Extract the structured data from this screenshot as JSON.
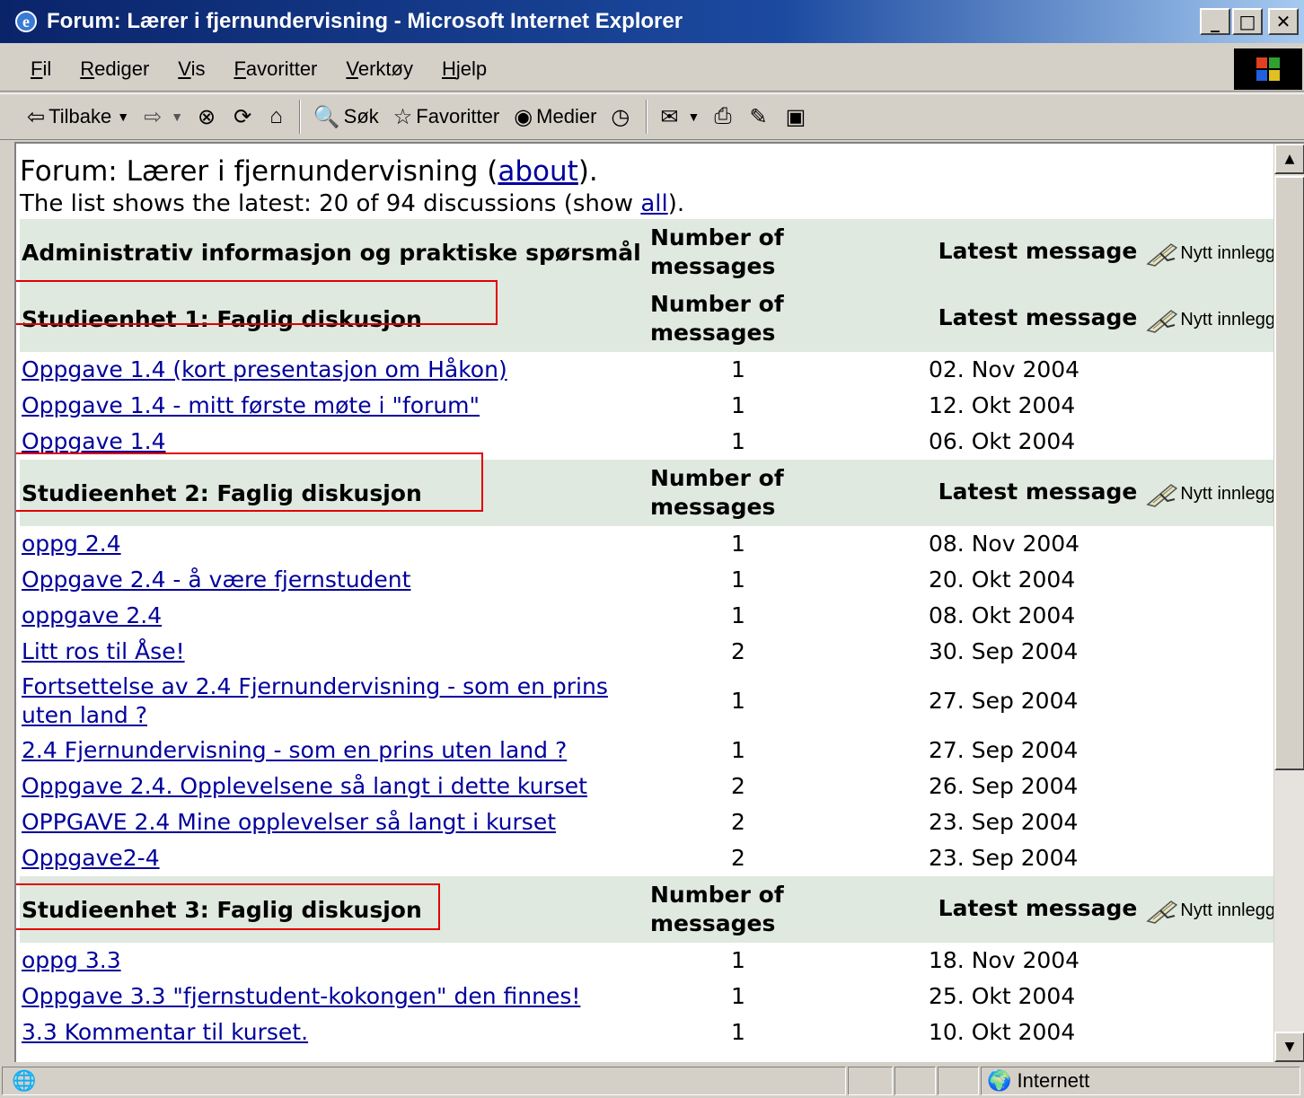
{
  "window": {
    "title": "Forum: Lærer i fjernundervisning - Microsoft Internet Explorer",
    "minimize": "_",
    "maximize": "□",
    "close": "✕"
  },
  "menu": [
    {
      "name": "menu-fil",
      "label": "Fil"
    },
    {
      "name": "menu-rediger",
      "label": "Rediger"
    },
    {
      "name": "menu-vis",
      "label": "Vis"
    },
    {
      "name": "menu-favoritter",
      "label": "Favoritter"
    },
    {
      "name": "menu-verktoy",
      "label": "Verktøy"
    },
    {
      "name": "menu-hjelp",
      "label": "Hjelp"
    }
  ],
  "toolbar": {
    "back": "Tilbake",
    "search": "Søk",
    "favorites": "Favoritter",
    "media": "Medier"
  },
  "page": {
    "title_prefix": "Forum: Lærer i fjernundervisning (",
    "about_link": "about",
    "title_suffix": ").",
    "list_info_prefix": "The list shows the latest: 20  of 94 discussions (show ",
    "all_link": "all",
    "list_info_suffix": ")."
  },
  "columns": {
    "count": "Number of messages",
    "latest": "Latest message",
    "new_post": "Nytt innlegg"
  },
  "sections": [
    {
      "name": "Administrativ informasjon og praktiske spørsmål",
      "threads": []
    },
    {
      "name": "Studieenhet 1: Faglig diskusjon",
      "threads": [
        {
          "subject": "Oppgave 1.4 (kort presentasjon om Håkon)",
          "count": "1",
          "date": "02. Nov 2004"
        },
        {
          "subject": "Oppgave 1.4 - mitt første møte i \"forum\"",
          "count": "1",
          "date": "12. Okt 2004"
        },
        {
          "subject": "Oppgave 1.4",
          "count": "1",
          "date": "06. Okt 2004"
        }
      ]
    },
    {
      "name": "Studieenhet 2: Faglig diskusjon",
      "threads": [
        {
          "subject": "oppg 2.4",
          "count": "1",
          "date": "08. Nov 2004"
        },
        {
          "subject": "Oppgave 2.4 - å være fjernstudent",
          "count": "1",
          "date": "20. Okt 2004"
        },
        {
          "subject": "oppgave 2.4",
          "count": "1",
          "date": "08. Okt 2004"
        },
        {
          "subject": "Litt ros til Åse!",
          "count": "2",
          "date": "30. Sep 2004"
        },
        {
          "subject": "Fortsettelse av 2.4 Fjernundervisning - som en prins uten land ?",
          "count": "1",
          "date": "27. Sep 2004"
        },
        {
          "subject": "2.4 Fjernundervisning - som en prins uten land ?",
          "count": "1",
          "date": "27. Sep 2004"
        },
        {
          "subject": "Oppgave 2.4. Opplevelsene så langt i dette kurset",
          "count": "2",
          "date": "26. Sep 2004"
        },
        {
          "subject": "OPPGAVE 2.4 Mine opplevelser så langt i kurset",
          "count": "2",
          "date": "23. Sep 2004"
        },
        {
          "subject": "Oppgave2-4",
          "count": "2",
          "date": "23. Sep 2004"
        }
      ]
    },
    {
      "name": "Studieenhet 3: Faglig diskusjon",
      "threads": [
        {
          "subject": "oppg 3.3",
          "count": "1",
          "date": "18. Nov 2004"
        },
        {
          "subject": "Oppgave 3.3 \"fjernstudent-kokongen\" den finnes!",
          "count": "1",
          "date": "25. Okt 2004"
        },
        {
          "subject": "3.3 Kommentar til kurset.",
          "count": "1",
          "date": "10. Okt 2004"
        }
      ]
    }
  ],
  "statusbar": {
    "zone": "Internett"
  },
  "colors": {
    "header_bg": "#dfe9df",
    "link": "#00009c",
    "annotation_box": "#e00000"
  }
}
